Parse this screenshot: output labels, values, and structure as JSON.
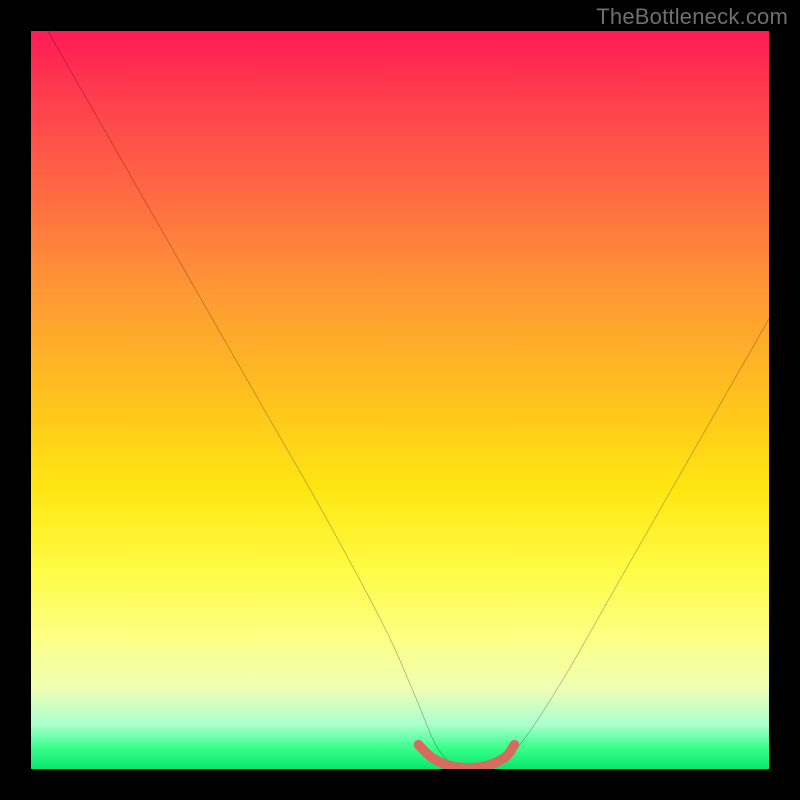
{
  "watermark": "TheBottleneck.com",
  "chart_data": {
    "type": "line",
    "title": "",
    "xlabel": "",
    "ylabel": "",
    "xlim": [
      0,
      100
    ],
    "ylim": [
      0,
      100
    ],
    "gradient_colors": {
      "top": "#ff1a55",
      "mid_upper": "#ff9a34",
      "mid": "#ffe612",
      "mid_lower": "#fdff82",
      "bottom": "#06e96b"
    },
    "series": [
      {
        "name": "bottleneck-curve",
        "color": "#000000",
        "x": [
          0,
          8,
          16,
          24,
          32,
          40,
          48,
          52,
          55,
          58,
          60,
          62,
          66,
          72,
          80,
          88,
          96,
          100
        ],
        "y": [
          104,
          90,
          76,
          62,
          48,
          34,
          19,
          10,
          3,
          0,
          0,
          0,
          3,
          12,
          26,
          40,
          54,
          61
        ]
      },
      {
        "name": "sweet-spot-band",
        "color": "#d86a60",
        "x": [
          52.5,
          54,
          55.5,
          57,
          58.5,
          60,
          61.5,
          63,
          64.5,
          65.5
        ],
        "y": [
          3.3,
          1.8,
          0.9,
          0.4,
          0.2,
          0.2,
          0.4,
          0.9,
          1.8,
          3.3
        ]
      }
    ]
  }
}
